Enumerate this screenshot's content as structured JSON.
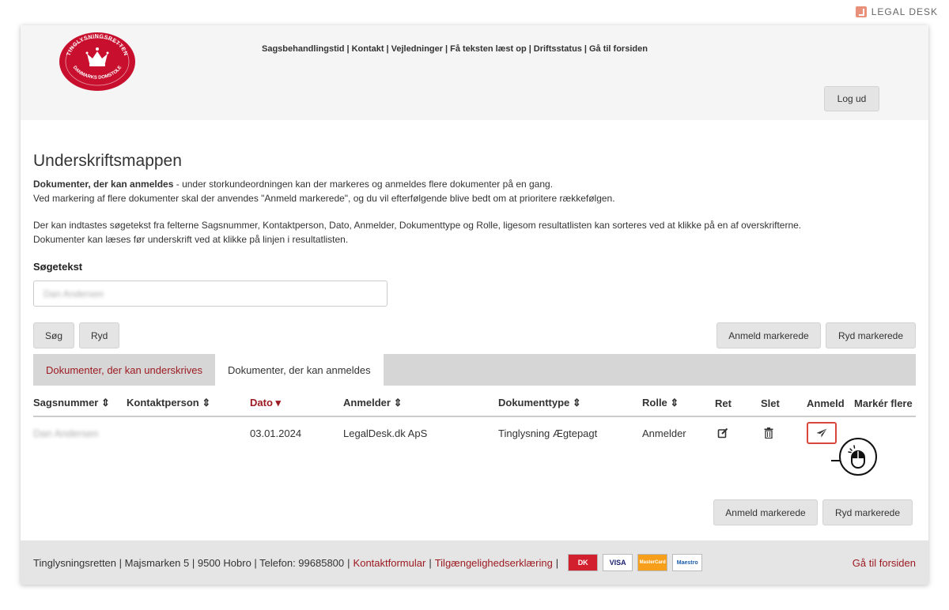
{
  "brand": {
    "name": "LEGAL DESK"
  },
  "header": {
    "seal": {
      "top_text": "TINGLYSNINGSRETTEN",
      "bottom_text": "DANMARKS DOMSTOLE"
    },
    "nav": [
      "Sagsbehandlingstid",
      "Kontakt",
      "Vejledninger",
      "Få teksten læst op",
      "Driftsstatus",
      "Gå til forsiden"
    ],
    "nav_separator": "|",
    "logout_label": "Log ud"
  },
  "page": {
    "title": "Underskriftsmappen",
    "intro_bold": "Dokumenter, der kan anmeldes",
    "intro_rest": " - under storkundeordningen kan der markeres og anmeldes flere dokumenter på en gang.",
    "intro_line2": "Ved markering af flere dokumenter skal der anvendes \"Anmeld markerede\", og du vil efterfølgende blive bedt om at prioritere rækkefølgen.",
    "search_help": "Der kan indtastes søgetekst fra felterne Sagsnummer, Kontaktperson, Dato, Anmelder, Dokumenttype og Rolle, ligesom resultatlisten kan sorteres ved at klikke på en af overskrifterne.",
    "read_help": "Dokumenter kan læses før underskrift ved at klikke på linjen i resultatlisten."
  },
  "search": {
    "label": "Søgetekst",
    "value": "Dan Andersen",
    "search_button": "Søg",
    "clear_button": "Ryd"
  },
  "bulk_actions": {
    "submit_marked": "Anmeld markerede",
    "clear_marked": "Ryd markerede"
  },
  "tabs": [
    {
      "label": "Dokumenter, der kan underskrives",
      "active": false
    },
    {
      "label": "Dokumenter, der kan anmeldes",
      "active": true
    }
  ],
  "table": {
    "columns": [
      "Sagsnummer ⇕",
      "Kontaktperson ⇕",
      "Dato ▾",
      "Anmelder ⇕",
      "Dokumenttype ⇕",
      "Rolle ⇕",
      "Ret",
      "Slet",
      "Anmeld",
      "Markér flere"
    ],
    "rows": [
      {
        "sagsnummer": "Dan Andersen",
        "kontaktperson": "",
        "dato": "03.01.2024",
        "anmelder": "LegalDesk.dk ApS",
        "dokumenttype": "Tinglysning Ægtepagt",
        "rolle": "Anmelder"
      }
    ]
  },
  "footer": {
    "address": "Tinglysningsretten | Majsmarken 5 | 9500 Hobro | Telefon: 99685800",
    "contact_form": "Kontaktformular",
    "accessibility": "Tilgængelighedserklæring",
    "separator": "|",
    "cards": [
      "DK",
      "VISA",
      "MasterCard",
      "Maestro"
    ],
    "home_link": "Gå til forsiden"
  },
  "colors": {
    "accent": "#9c1b22",
    "highlight": "#d9463a"
  }
}
